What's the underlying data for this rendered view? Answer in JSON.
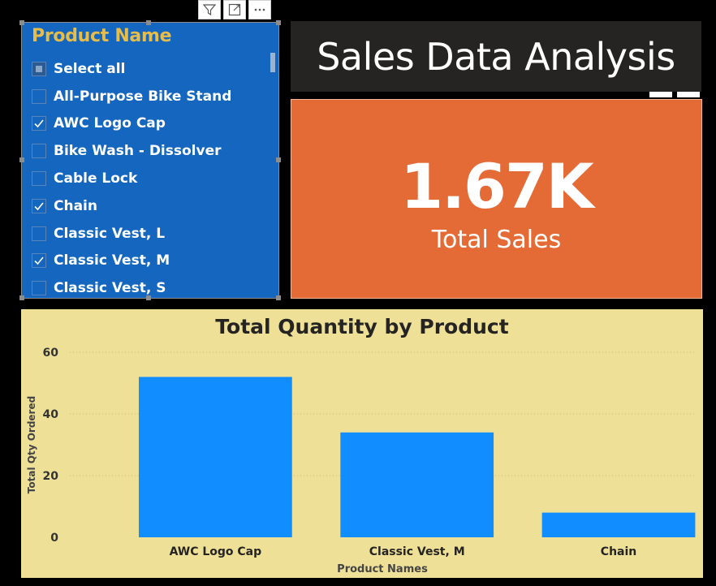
{
  "slicer": {
    "title": "Product Name",
    "items": [
      {
        "label": "Select all",
        "state": "partial"
      },
      {
        "label": "All-Purpose Bike Stand",
        "state": "unchecked"
      },
      {
        "label": "AWC Logo Cap",
        "state": "checked"
      },
      {
        "label": "Bike Wash - Dissolver",
        "state": "unchecked"
      },
      {
        "label": "Cable Lock",
        "state": "unchecked"
      },
      {
        "label": "Chain",
        "state": "checked"
      },
      {
        "label": "Classic Vest, L",
        "state": "unchecked"
      },
      {
        "label": "Classic Vest, M",
        "state": "checked"
      },
      {
        "label": "Classic Vest, S",
        "state": "unchecked"
      }
    ]
  },
  "toolbar": {
    "icons": [
      "filter-icon",
      "focus-mode-icon",
      "more-options-icon"
    ]
  },
  "header": {
    "title": "Sales Data Analysis"
  },
  "kpi": {
    "value": "1.67K",
    "label": "Total Sales"
  },
  "colors": {
    "slicer_bg": "#1466be",
    "slicer_title": "#e6bd4a",
    "kpi_bg": "#e56b36",
    "chart_bg": "#efe097",
    "bar": "#118dff",
    "title_bg": "#252423"
  },
  "chart_data": {
    "type": "bar",
    "title": "Total Quantity by Product",
    "xlabel": "Product Names",
    "ylabel": "Total Qty Ordered",
    "categories": [
      "AWC Logo Cap",
      "Classic Vest, M",
      "Chain"
    ],
    "values": [
      52,
      34,
      8
    ],
    "ylim": [
      0,
      60
    ],
    "yticks": [
      0,
      20,
      40,
      60
    ],
    "grid": true,
    "legend": "none"
  }
}
